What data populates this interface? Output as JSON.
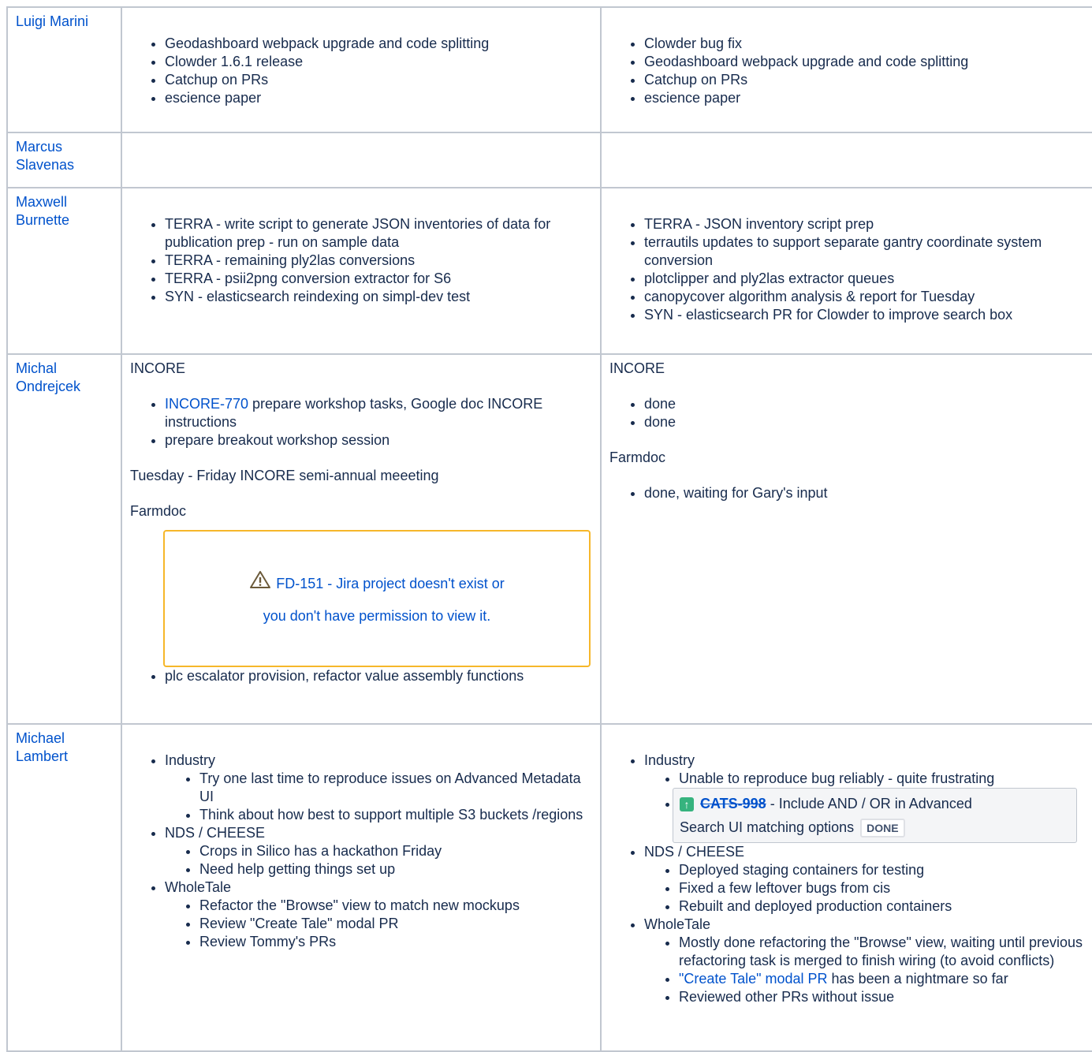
{
  "rows": [
    {
      "name": "Luigi Marini",
      "last_week": [
        "Geodashboard webpack upgrade and code splitting",
        "Clowder 1.6.1 release",
        "Catchup on PRs",
        "escience paper"
      ],
      "this_week": [
        "Clowder bug fix",
        "Geodashboard webpack upgrade and code splitting",
        "Catchup on PRs",
        "escience paper"
      ]
    },
    {
      "name": "Marcus Slavenas"
    },
    {
      "name": "Maxwell Burnette",
      "last_week": [
        "TERRA - write script to generate JSON inventories of data for publication prep - run on sample data",
        "TERRA - remaining ply2las conversions",
        "TERRA - psii2png conversion extractor for S6",
        "SYN - elasticsearch reindexing on simpl-dev test"
      ],
      "this_week": [
        "TERRA - JSON inventory script prep",
        "terrautils updates to support separate gantry coordinate system conversion",
        "plotclipper and ply2las extractor queues",
        "canopycover algorithm analysis & report for Tuesday",
        "SYN - elasticsearch PR for Clowder to improve search box"
      ]
    },
    {
      "name": "Michal Ondrejcek",
      "last_heading": "INCORE",
      "last_link": "INCORE-770",
      "last_item1_rest": " prepare workshop tasks, Google doc INCORE instructions",
      "last_item2": "prepare breakout workshop session",
      "last_meeting": "Tuesday - Friday INCORE semi-annual meeeting",
      "last_farmdoc": "Farmdoc",
      "jira_error_key": "FD-151",
      "jira_error_msg_1": " - Jira project doesn't exist or",
      "jira_error_msg_2": "you don't have permission to view it.",
      "last_after_jira": "plc escalator provision, refactor value assembly functions",
      "this_heading": "INCORE",
      "this_items": [
        "done",
        "done"
      ],
      "this_farmdoc": "Farmdoc",
      "this_farmdoc_items": [
        "done, waiting for Gary's input"
      ]
    },
    {
      "name": "Michael Lambert",
      "last": {
        "industry": "Industry",
        "industry_items": [
          "Try one last time to reproduce issues on Advanced Metadata UI",
          "Think about how best to support multiple S3 buckets /regions"
        ],
        "nds": "NDS / CHEESE",
        "nds_items": [
          "Crops in Silico has a hackathon Friday",
          "Need help getting things set up"
        ],
        "wt": "WholeTale",
        "wt_items": [
          "Refactor the \"Browse\" view to match new mockups",
          "Review \"Create Tale\" modal PR",
          "Review Tommy's PRs"
        ]
      },
      "this": {
        "industry": "Industry",
        "industry_item": "Unable to reproduce bug reliably - quite frustrating",
        "jira_key": "CATS-998",
        "jira_summary_1": " - Include AND / OR in Advanced",
        "jira_summary_2": "Search UI matching options",
        "jira_status": "DONE",
        "nds": "NDS / CHEESE",
        "nds_items": [
          "Deployed staging containers for testing",
          "Fixed a few leftover bugs from cis",
          "Rebuilt and deployed production containers"
        ],
        "wt": "WholeTale",
        "wt_item1": "Mostly done refactoring the \"Browse\" view, waiting until previous refactoring task is merged to finish wiring (to avoid conflicts)",
        "wt_link": "\"Create Tale\" modal PR",
        "wt_link_rest": " has been a nightmare so far",
        "wt_item3": "Reviewed other PRs without issue"
      }
    }
  ]
}
